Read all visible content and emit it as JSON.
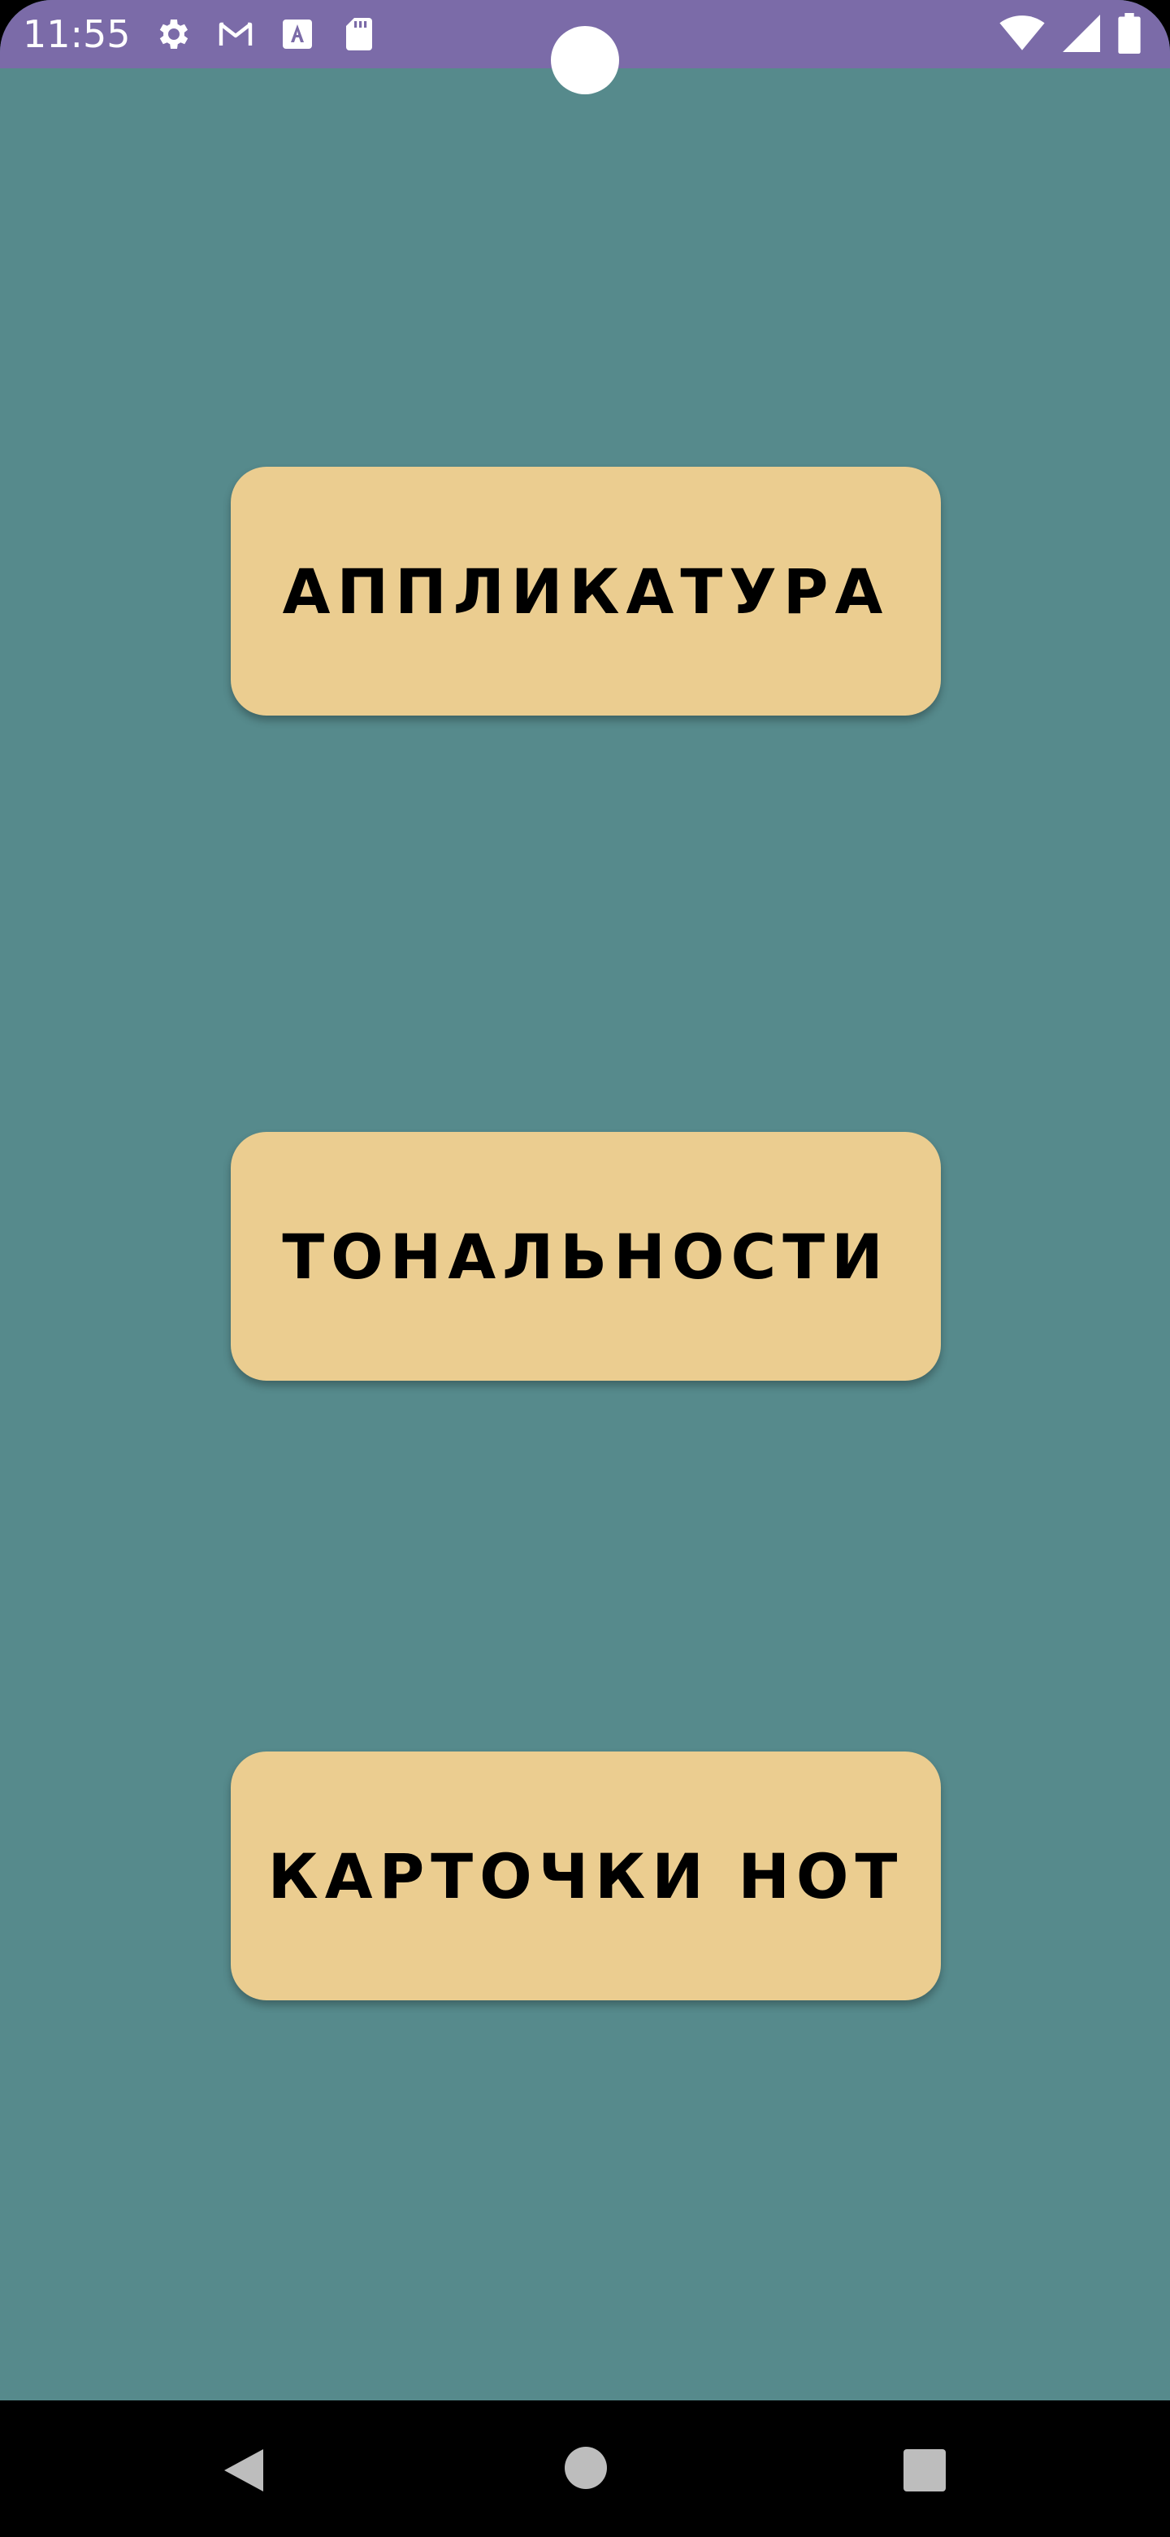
{
  "status_bar": {
    "time": "11:55",
    "background": "#7b6ba8",
    "icons_left": [
      "gear-icon",
      "gmail-icon",
      "a-text-icon",
      "sd-card-icon"
    ],
    "icons_right": [
      "wifi-icon",
      "cell-signal-icon",
      "battery-icon"
    ]
  },
  "screen": {
    "background": "#568a8c"
  },
  "menu": {
    "button_color": "#ebcd90",
    "items": [
      {
        "label": "АППЛИКАТУРА"
      },
      {
        "label": "ТОНАЛЬНОСТИ"
      },
      {
        "label": "КАРТОЧКИ НОТ"
      }
    ]
  },
  "navigation_bar": {
    "buttons": [
      "back-icon",
      "home-icon",
      "recents-icon"
    ]
  }
}
